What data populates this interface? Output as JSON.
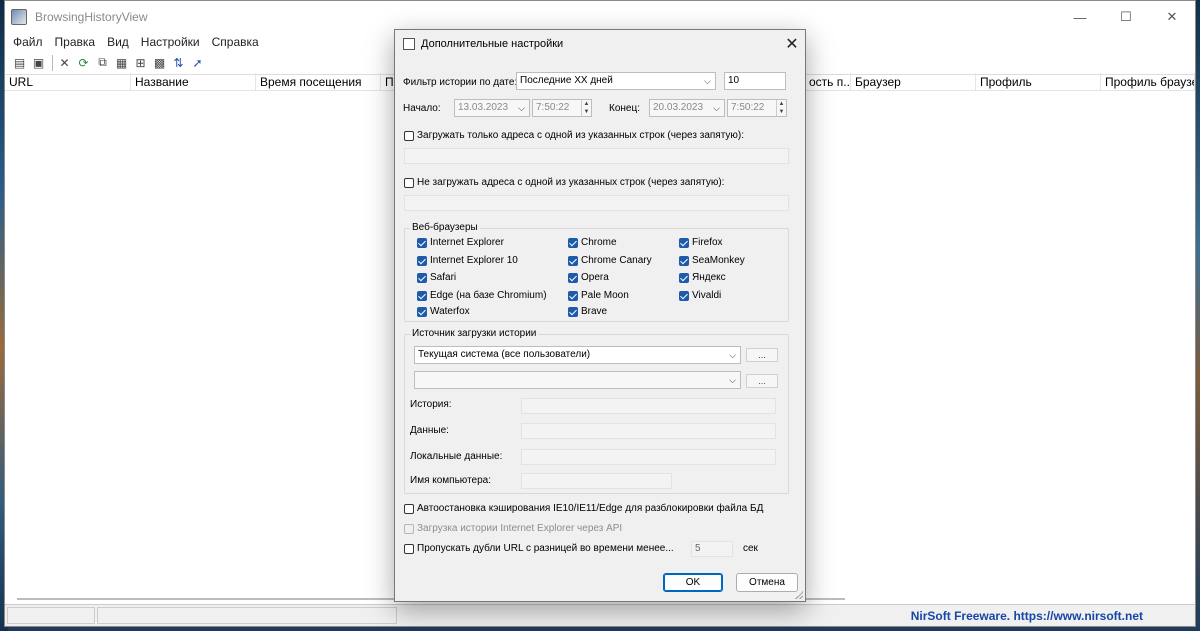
{
  "app": {
    "title": "BrowsingHistoryView"
  },
  "window_controls": {
    "minimize": "—",
    "maximize": "☐",
    "close": "✕"
  },
  "menu": [
    "Файл",
    "Правка",
    "Вид",
    "Настройки",
    "Справка"
  ],
  "toolbar_icons": [
    "new-icon",
    "save-icon",
    "delete-icon",
    "refresh-icon",
    "copy-icon",
    "properties-icon",
    "html-report-icon",
    "grid-icon",
    "sort-icon",
    "exit-icon"
  ],
  "columns": [
    "URL",
    "Название",
    "Время посещения",
    "П",
    "ость п...",
    "Браузер",
    "Профиль",
    "Профиль браузера"
  ],
  "status": {
    "link": "NirSoft Freeware. https://www.nirsoft.net"
  },
  "dialog": {
    "title": "Дополнительные настройки",
    "close": "✕",
    "filter_label": "Фильтр истории по дате:",
    "filter_value": "Последние XX дней",
    "days_value": "10",
    "start_label": "Начало:",
    "start_date": "13.03.2023",
    "start_time": "7:50:22",
    "end_label": "Конец:",
    "end_date": "20.03.2023",
    "end_time": "7:50:22",
    "load_only_label": "Загружать только адреса с одной из указанных строк (через запятую):",
    "dont_load_label": "Не загружать адреса с одной из указанных строк (через запятую):",
    "browsers_group": "Веб-браузеры",
    "browsers": [
      "Internet Explorer",
      "Chrome",
      "Firefox",
      "Internet Explorer 10",
      "Chrome Canary",
      "SeaMonkey",
      "Safari",
      "Opera",
      "Яндекс",
      "Edge (на базе Chromium)",
      "Pale Moon",
      "Vivaldi",
      "Waterfox",
      "Brave"
    ],
    "source_group": "Источник загрузки истории",
    "source_value": "Текущая система (все пользователи)",
    "dots": "...",
    "history_label": "История:",
    "data_label": "Данные:",
    "local_data_label": "Локальные данные:",
    "computer_label": "Имя компьютера:",
    "autostop_label": "Автоостановка кэширования IE10/IE11/Edge для разблокировки файла БД",
    "ie_api_label": "Загрузка истории Internet Explorer через API",
    "skip_dup_label": "Пропускать дубли URL с разницей во времени менее...",
    "skip_seconds": "5",
    "seconds_unit": "сек",
    "ok": "OK",
    "cancel": "Отмена"
  }
}
